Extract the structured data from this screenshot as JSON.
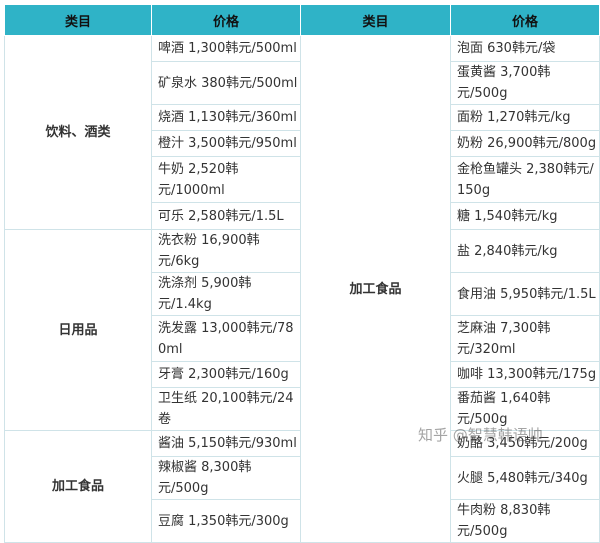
{
  "headers": [
    "类目",
    "价格",
    "类目",
    "价格"
  ],
  "left": [
    {
      "category": "饮料、酒类",
      "items": [
        "啤酒 1,300韩元/500ml",
        "矿泉水 380韩元/500ml",
        "烧酒 1,130韩元/360ml",
        "橙汁 3,500韩元/950ml",
        "牛奶 2,520韩元/1000ml",
        "可乐 2,580韩元/1.5L"
      ]
    },
    {
      "category": "日用品",
      "items": [
        "洗衣粉 16,900韩元/6kg",
        "洗涤剂 5,900韩元/1.4kg",
        "洗发露 13,000韩元/780ml",
        "牙膏 2,300韩元/160g",
        "卫生纸 20,100韩元/24卷"
      ]
    },
    {
      "category": "加工食品",
      "items": [
        "酱油 5,150韩元/930ml",
        "辣椒酱 8,300韩元/500g",
        "豆腐 1,350韩元/300g"
      ]
    }
  ],
  "right": {
    "category": "加工食品",
    "items": [
      "泡面 630韩元/袋",
      "蛋黄酱 3,700韩元/500g",
      "面粉 1,270韩元/kg",
      "奶粉 26,900韩元/800g",
      "金枪鱼罐头 2,380韩元/150g",
      "糖 1,540韩元/kg",
      "盐 2,840韩元/kg",
      "食用油 5,950韩元/1.5L",
      "芝麻油 7,300韩元/320ml",
      "咖啡 13,300韩元/175g",
      "番茄酱 1,640韩元/500g",
      "奶酪 3,450韩元/200g",
      "火腿 5,480韩元/340g",
      "牛肉粉 8,830韩元/500g"
    ]
  },
  "watermark": "知乎 @智慧韩语帅"
}
